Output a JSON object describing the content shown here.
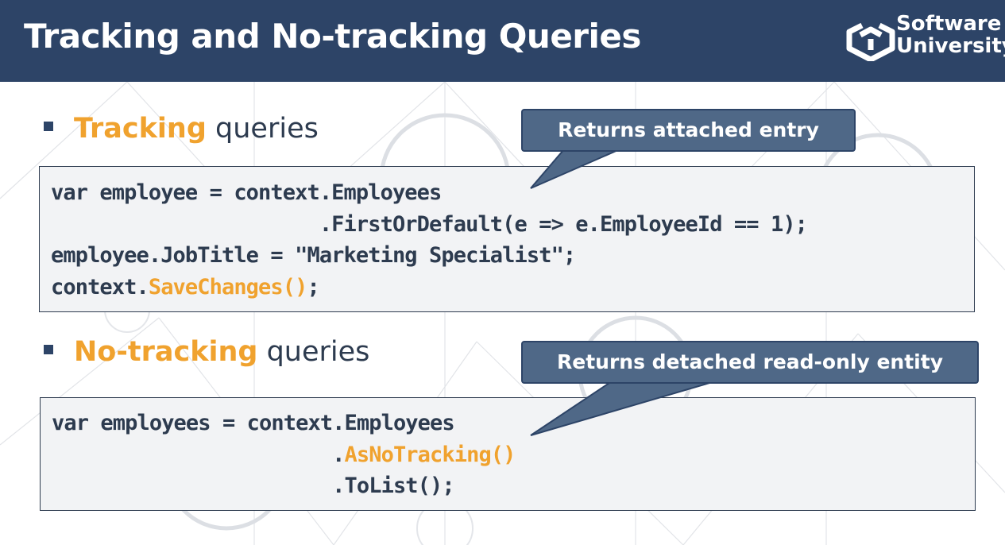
{
  "slide": {
    "title": "Tracking and No-tracking Queries",
    "logo": {
      "line1": "Software",
      "line2": "University"
    }
  },
  "sections": [
    {
      "highlight": "Tracking",
      "rest": " queries",
      "callout": "Returns attached entry",
      "code": [
        {
          "parts": [
            {
              "text": "var employee = context.Employees"
            }
          ]
        },
        {
          "parts": [
            {
              "text": "                      .FirstOrDefault(e => e.EmployeeId == 1);"
            }
          ]
        },
        {
          "parts": [
            {
              "text": "employee.JobTitle = \"Marketing Specialist\";"
            }
          ]
        },
        {
          "parts": [
            {
              "text": "context."
            },
            {
              "text": "SaveChanges()",
              "accent": true
            },
            {
              "text": ";"
            }
          ]
        }
      ]
    },
    {
      "highlight": "No-tracking",
      "rest": " queries",
      "callout": "Returns detached read-only entity",
      "code": [
        {
          "parts": [
            {
              "text": "var employees = context.Employees"
            }
          ]
        },
        {
          "parts": [
            {
              "text": "                       ."
            },
            {
              "text": "AsNoTracking()",
              "accent": true
            }
          ]
        },
        {
          "parts": [
            {
              "text": "                       .ToList();"
            }
          ]
        }
      ]
    }
  ],
  "colors": {
    "header": "#2d4467",
    "accent": "#f0a22e",
    "callout": "#4f6887",
    "code_bg": "#f2f3f5"
  }
}
